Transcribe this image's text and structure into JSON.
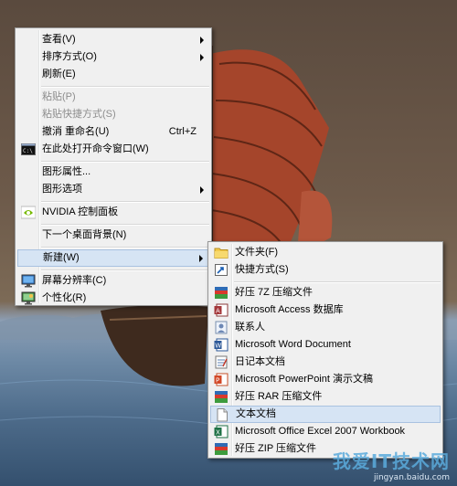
{
  "context_menu": {
    "items": [
      {
        "label": "查看(V)",
        "submenu": true
      },
      {
        "label": "排序方式(O)",
        "submenu": true
      },
      {
        "label": "刷新(E)"
      },
      {
        "label": "粘贴(P)",
        "disabled": true
      },
      {
        "label": "粘贴快捷方式(S)",
        "disabled": true
      },
      {
        "label": "撤消 重命名(U)",
        "shortcut": "Ctrl+Z"
      },
      {
        "label": "在此处打开命令窗口(W)",
        "icon": "command-prompt-icon"
      },
      {
        "label": "图形属性..."
      },
      {
        "label": "图形选项",
        "submenu": true
      },
      {
        "label": "NVIDIA 控制面板",
        "icon": "nvidia-icon"
      },
      {
        "label": "下一个桌面背景(N)"
      },
      {
        "label": "新建(W)",
        "submenu": true,
        "highlighted": true
      },
      {
        "label": "屏幕分辨率(C)",
        "icon": "screen-resolution-icon"
      },
      {
        "label": "个性化(R)",
        "icon": "personalize-icon"
      }
    ]
  },
  "new_submenu": {
    "items": [
      {
        "label": "文件夹(F)",
        "icon": "folder-icon"
      },
      {
        "label": "快捷方式(S)",
        "icon": "shortcut-icon"
      },
      {
        "label": "好压 7Z 压缩文件",
        "icon": "haozip-7z-icon"
      },
      {
        "label": "Microsoft Access 数据库",
        "icon": "access-icon"
      },
      {
        "label": "联系人",
        "icon": "contact-icon"
      },
      {
        "label": "Microsoft Word Document",
        "icon": "word-icon"
      },
      {
        "label": "日记本文档",
        "icon": "journal-icon"
      },
      {
        "label": "Microsoft PowerPoint 演示文稿",
        "icon": "powerpoint-icon"
      },
      {
        "label": "好压 RAR 压缩文件",
        "icon": "haozip-rar-icon"
      },
      {
        "label": "文本文档",
        "icon": "text-document-icon",
        "highlighted": true
      },
      {
        "label": "Microsoft Office Excel 2007 Workbook",
        "icon": "excel-icon"
      },
      {
        "label": "好压 ZIP 压缩文件",
        "icon": "haozip-zip-icon"
      }
    ]
  },
  "watermark": {
    "title": "我爱IT技术网",
    "url": "jingyan.baidu.com"
  },
  "colors": {
    "menu_bg": "#f0f0f0",
    "highlight_bg": "#d6e4f4",
    "highlight_border": "#a9c2e0",
    "disabled_text": "#8d8d8d"
  }
}
